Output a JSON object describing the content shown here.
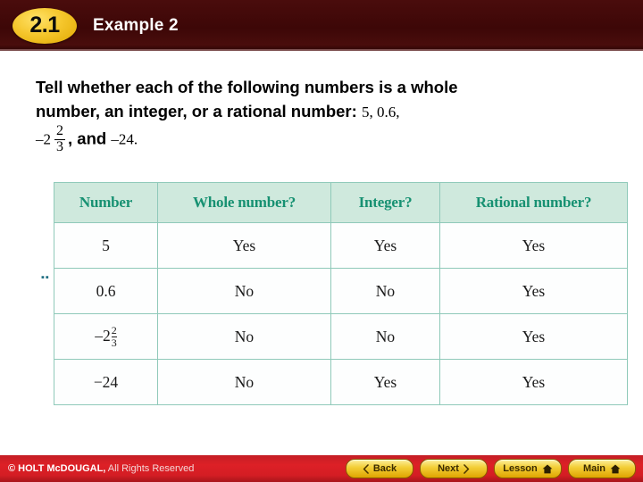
{
  "header": {
    "badge": "2.1",
    "title": "Example 2"
  },
  "problem": {
    "line1": "Tell whether each of the following numbers is a whole",
    "line2_bold": "number, an integer, or a rational number:",
    "line2_math": "5, 0.6,",
    "line3_lead": "–2",
    "line3_frac_num": "2",
    "line3_frac_den": "3",
    "line3_mid": ", and",
    "line3_tail": "–24."
  },
  "table": {
    "columns": [
      "Number",
      "Whole number?",
      "Integer?",
      "Rational number?"
    ],
    "rows": [
      {
        "number": "5",
        "number_type": "plain",
        "whole_number": "Yes",
        "integer": "Yes",
        "rational_number": "Yes"
      },
      {
        "number": "0.6",
        "number_type": "plain",
        "whole_number": "No",
        "integer": "No",
        "rational_number": "Yes"
      },
      {
        "number": "–2",
        "number_type": "mixed",
        "frac_num": "2",
        "frac_den": "3",
        "whole_number": "No",
        "integer": "No",
        "rational_number": "Yes"
      },
      {
        "number": "−24",
        "number_type": "plain",
        "whole_number": "No",
        "integer": "Yes",
        "rational_number": "Yes"
      }
    ],
    "stray_mark": "▪▪"
  },
  "footer": {
    "copyright_strong": "© HOLT McDOUGAL,",
    "copyright_light": "All Rights Reserved",
    "nav": [
      {
        "label": "Back",
        "icon": "chevron-left-icon"
      },
      {
        "label": "Next",
        "icon": "chevron-right-icon"
      },
      {
        "label": "Lesson",
        "icon": "home-icon"
      },
      {
        "label": "Main",
        "icon": "home-icon"
      }
    ]
  },
  "colors": {
    "header_bg": "#3d0707",
    "badge_gold": "#f5c62c",
    "table_header_bg": "#cfe9dd",
    "table_header_text": "#179172",
    "table_border": "#8fc9b9",
    "footer_red": "#dd2026",
    "nav_gold": "#f3cf38"
  }
}
